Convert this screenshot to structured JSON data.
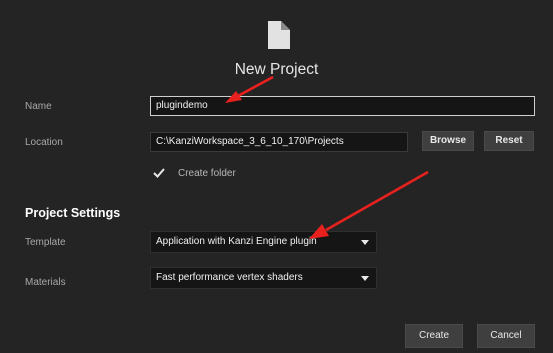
{
  "dialog": {
    "title": "New Project",
    "icon": "document-icon"
  },
  "fields": {
    "name": {
      "label": "Name",
      "value": "plugindemo"
    },
    "location": {
      "label": "Location",
      "value": "C:\\KanziWorkspace_3_6_10_170\\Projects"
    },
    "browse_label": "Browse",
    "reset_label": "Reset",
    "create_folder": {
      "label": "Create folder",
      "checked": true
    }
  },
  "project_settings": {
    "heading": "Project Settings",
    "template": {
      "label": "Template",
      "value": "Application with Kanzi Engine plugin"
    },
    "materials": {
      "label": "Materials",
      "value": "Fast performance vertex shaders"
    }
  },
  "footer": {
    "create_label": "Create",
    "cancel_label": "Cancel"
  },
  "colors": {
    "background": "#242424",
    "annotation_arrow": "#e8211e"
  }
}
